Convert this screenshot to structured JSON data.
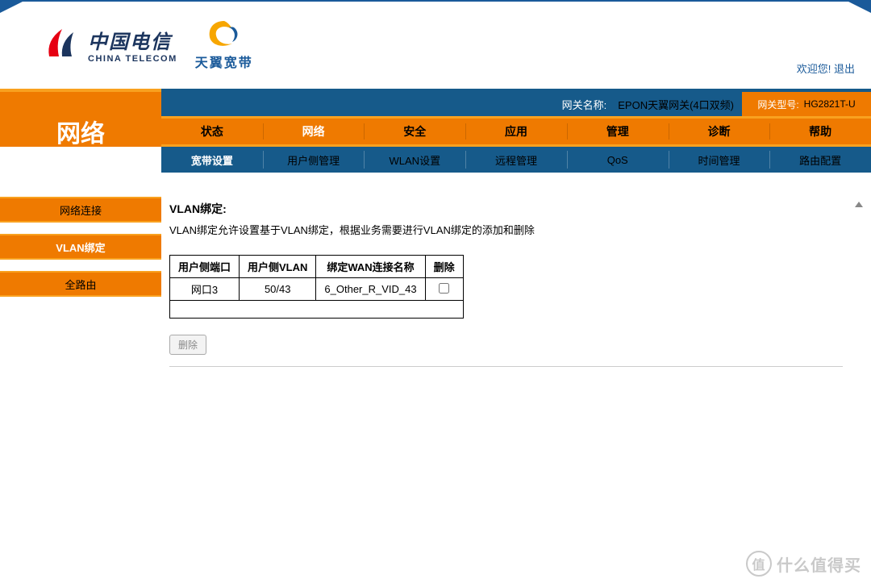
{
  "header": {
    "logo_cn": "中国电信",
    "logo_en": "CHINA TELECOM",
    "broadband_label": "天翼宽带",
    "welcome_text": "欢迎您!",
    "logout_text": "退出"
  },
  "banner": {
    "gateway_name_label": "网关名称:",
    "gateway_name_value": "EPON天翼网关(4口双频)",
    "model_label": "网关型号:",
    "model_value": "HG2821T-U"
  },
  "nav": {
    "section_title": "网络",
    "items": [
      {
        "label": "状态",
        "active": false
      },
      {
        "label": "网络",
        "active": true
      },
      {
        "label": "安全",
        "active": false
      },
      {
        "label": "应用",
        "active": false
      },
      {
        "label": "管理",
        "active": false
      },
      {
        "label": "诊断",
        "active": false
      },
      {
        "label": "帮助",
        "active": false
      }
    ]
  },
  "subnav": {
    "items": [
      {
        "label": "宽带设置",
        "active": true
      },
      {
        "label": "用户侧管理",
        "active": false
      },
      {
        "label": "WLAN设置",
        "active": false
      },
      {
        "label": "远程管理",
        "active": false
      },
      {
        "label": "QoS",
        "active": false
      },
      {
        "label": "时间管理",
        "active": false
      },
      {
        "label": "路由配置",
        "active": false
      }
    ]
  },
  "sidebar": {
    "items": [
      {
        "label": "网络连接",
        "active": false
      },
      {
        "label": "VLAN绑定",
        "active": true
      },
      {
        "label": "全路由",
        "active": false
      }
    ]
  },
  "content": {
    "title": "VLAN绑定:",
    "desc": "VLAN绑定允许设置基于VLAN绑定，根据业务需要进行VLAN绑定的添加和删除",
    "table": {
      "headers": [
        "用户侧端口",
        "用户侧VLAN",
        "绑定WAN连接名称",
        "删除"
      ],
      "rows": [
        {
          "port": "网口3",
          "vlan": "50/43",
          "wan": "6_Other_R_VID_43"
        }
      ]
    },
    "delete_button": "删除"
  },
  "watermark": {
    "badge": "值",
    "text": "什么值得买"
  }
}
